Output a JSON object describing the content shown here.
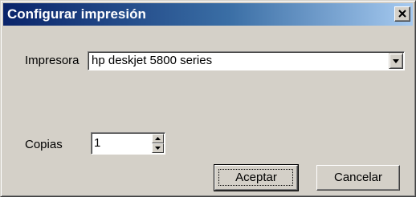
{
  "dialog": {
    "title": "Configurar impresión"
  },
  "printer": {
    "label": "Impresora",
    "selected": "hp deskjet 5800 series"
  },
  "copies": {
    "label": "Copias",
    "value": "1"
  },
  "buttons": {
    "accept": "Aceptar",
    "cancel": "Cancelar"
  },
  "icons": {
    "close": "close-icon",
    "dropdown": "chevron-down-icon",
    "spin_up": "arrow-up-icon",
    "spin_down": "arrow-down-icon"
  },
  "colors": {
    "titlebar_start": "#0a246a",
    "titlebar_end": "#a6caf0",
    "face": "#d4d0c8"
  }
}
